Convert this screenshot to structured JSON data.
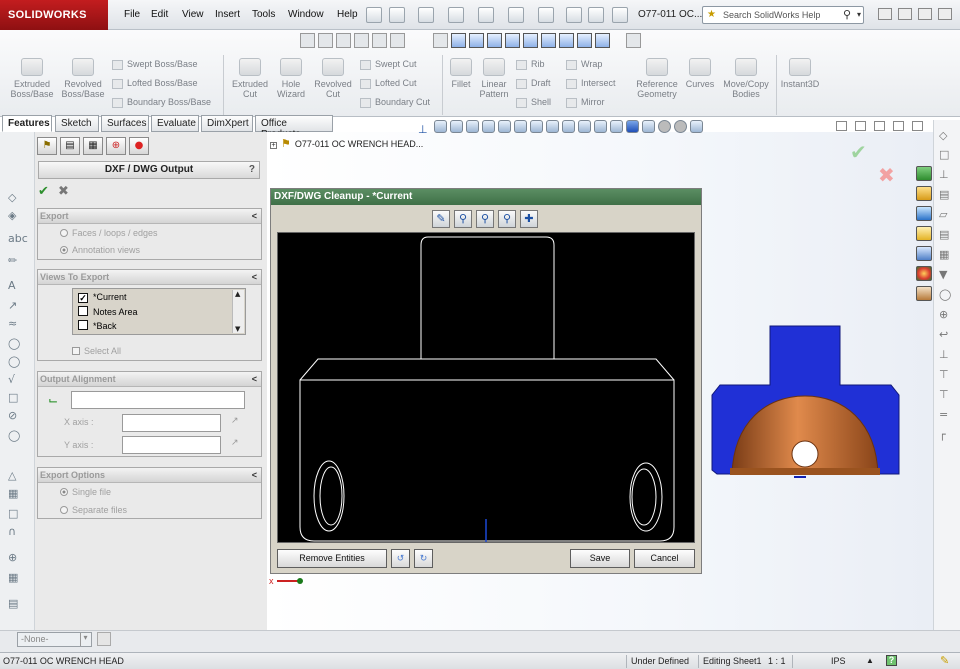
{
  "app": {
    "brand": "SOLIDWORKS",
    "document_title": "O77-011 OC..."
  },
  "menu": [
    "File",
    "Edit",
    "View",
    "Insert",
    "Tools",
    "Window",
    "Help"
  ],
  "search": {
    "placeholder": "Search SolidWorks Help"
  },
  "command_manager": {
    "big_buttons": [
      {
        "label1": "Extruded",
        "label2": "Boss/Base"
      },
      {
        "label1": "Revolved",
        "label2": "Boss/Base"
      },
      {
        "label1": "Extruded",
        "label2": "Cut"
      },
      {
        "label1": "Hole",
        "label2": "Wizard"
      },
      {
        "label1": "Revolved",
        "label2": "Cut"
      },
      {
        "label1": "Fillet",
        "label2": ""
      },
      {
        "label1": "Linear",
        "label2": "Pattern"
      },
      {
        "label1": "Reference",
        "label2": "Geometry"
      },
      {
        "label1": "Curves",
        "label2": ""
      },
      {
        "label1": "Move/Copy",
        "label2": "Bodies"
      },
      {
        "label1": "Instant3D",
        "label2": ""
      }
    ],
    "small_buttons": {
      "col1": [
        "Swept Boss/Base",
        "Lofted Boss/Base",
        "Boundary Boss/Base"
      ],
      "col2": [
        "Swept Cut",
        "Lofted Cut",
        "Boundary Cut"
      ],
      "col3": [
        "Rib",
        "Draft",
        "Shell"
      ],
      "col4": [
        "Wrap",
        "Intersect",
        "Mirror"
      ]
    }
  },
  "tabs": [
    "Features",
    "Sketch",
    "Surfaces",
    "Evaluate",
    "DimXpert",
    "Office Products"
  ],
  "property_manager": {
    "title": "DXF / DWG Output",
    "help": "?",
    "export": {
      "header": "Export",
      "options": [
        "Faces / loops / edges",
        "Annotation views"
      ]
    },
    "views_to_export": {
      "header": "Views To Export",
      "items": [
        {
          "label": "*Current",
          "checked": true
        },
        {
          "label": "Notes Area",
          "checked": false
        },
        {
          "label": "*Back",
          "checked": false
        }
      ],
      "select_all": "Select All"
    },
    "output_alignment": {
      "header": "Output Alignment",
      "x_axis": "X axis :",
      "y_axis": "Y axis :"
    },
    "export_options": {
      "header": "Export Options",
      "options": [
        "Single file",
        "Separate files"
      ]
    }
  },
  "feature_tree": {
    "root": "O77-011 OC WRENCH HEAD..."
  },
  "dialog": {
    "title": "DXF/DWG Cleanup - *Current",
    "buttons": {
      "remove": "Remove Entities",
      "save": "Save",
      "cancel": "Cancel"
    }
  },
  "bottom": {
    "config_select": "-None-"
  },
  "status": {
    "filename": "O77-011 OC WRENCH HEAD",
    "state": "Under Defined",
    "editing": "Editing Sheet1",
    "scale": "1 : 1",
    "units": "IPS",
    "help": "?"
  },
  "colors": {
    "model_blue": "#1f2fd8",
    "model_bronze": "#c0652b",
    "dialog_title": "#4a7d52",
    "canvas": "#000000"
  }
}
